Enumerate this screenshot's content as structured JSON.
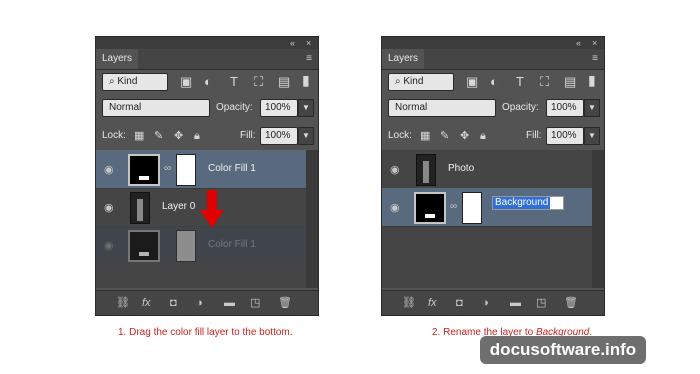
{
  "panel1": {
    "title": "Layers",
    "filter_label": "Kind",
    "blend_mode": "Normal",
    "opacity_label": "Opacity:",
    "opacity_value": "100%",
    "lock_label": "Lock:",
    "fill_label": "Fill:",
    "fill_value": "100%",
    "layers": [
      {
        "name": "Color Fill 1",
        "selected": true
      },
      {
        "name": "Layer 0",
        "selected": false
      },
      {
        "name": "Color Fill 1",
        "ghost": true
      }
    ],
    "caption": "1. Drag the color fill layer to the bottom."
  },
  "panel2": {
    "title": "Layers",
    "filter_label": "Kind",
    "blend_mode": "Normal",
    "opacity_label": "Opacity:",
    "opacity_value": "100%",
    "lock_label": "Lock:",
    "fill_label": "Fill:",
    "fill_value": "100%",
    "layers": [
      {
        "name": "Photo",
        "selected": false
      },
      {
        "name": "Background",
        "selected": true,
        "editing": true
      }
    ],
    "caption_prefix": "2. Rename the layer to ",
    "caption_emph": "Background",
    "caption_suffix": "."
  },
  "icons": {
    "collapse": "«",
    "close": "×",
    "menu": "≡",
    "search": "⌕",
    "eye": "◉",
    "chain": "⛓"
  },
  "watermark": "docusoftware.info",
  "colors": {
    "panel_bg": "#535353",
    "selected_row": "#5a6a7e",
    "caption_red": "#cc2222",
    "arrow_red": "#e00000"
  }
}
